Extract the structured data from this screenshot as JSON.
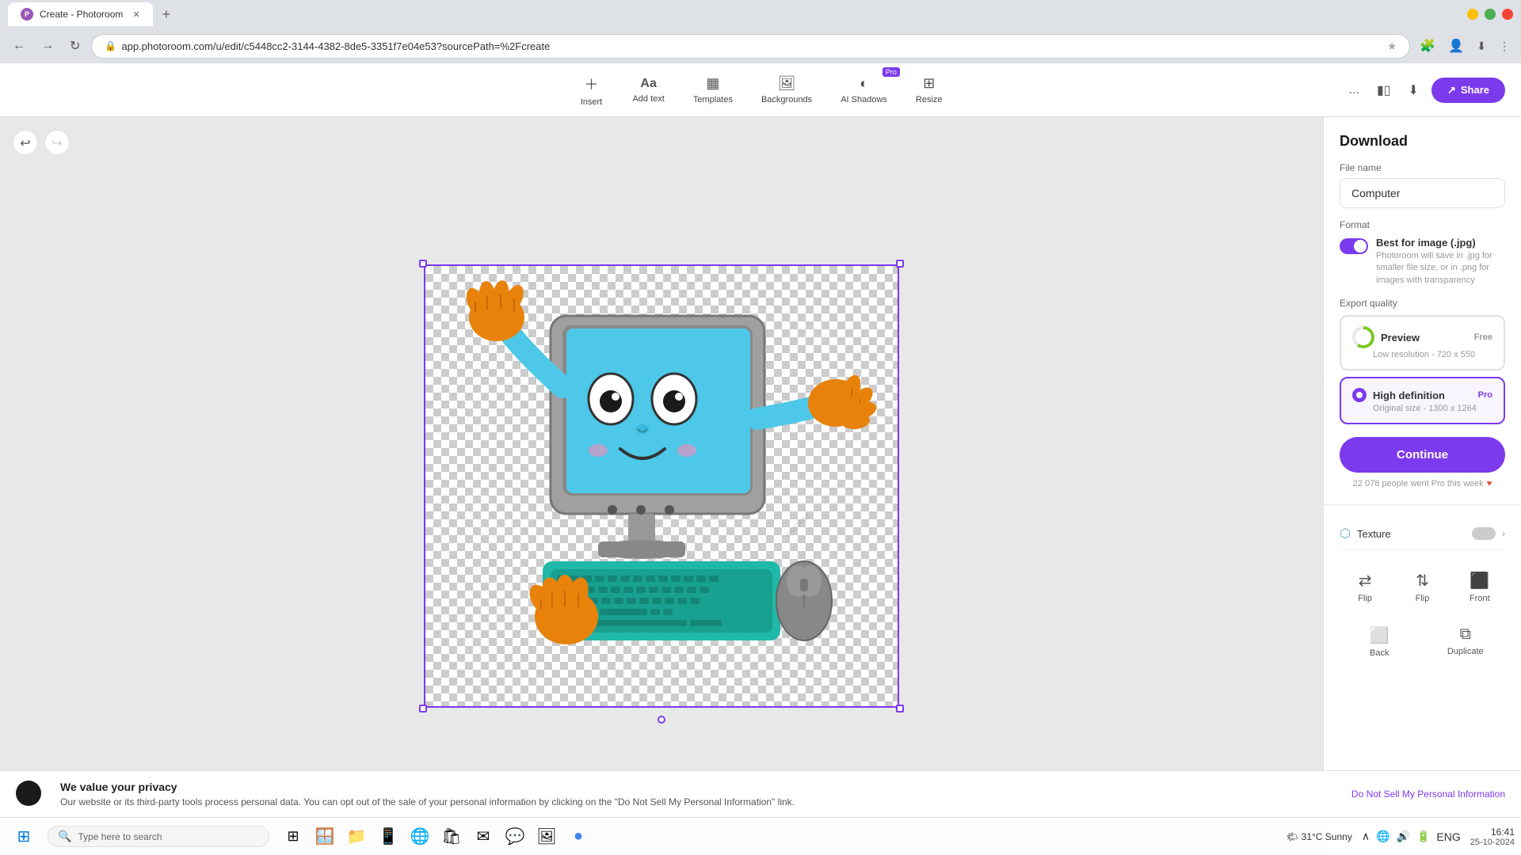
{
  "browser": {
    "tab_title": "Create - Photoroom",
    "url": "app.photoroom.com/u/edit/c5448cc2-3144-4382-8de5-3351f7e04e53?sourcePath=%2Fcreate",
    "new_tab_label": "+",
    "window_controls": [
      "minimize",
      "maximize",
      "close"
    ]
  },
  "toolbar": {
    "insert_label": "Insert",
    "add_text_label": "Add text",
    "templates_label": "Templates",
    "backgrounds_label": "Backgrounds",
    "ai_shadows_label": "AI Shadows",
    "resize_label": "Resize",
    "share_label": "Share",
    "more_label": "..."
  },
  "download_panel": {
    "title": "Download",
    "file_name_label": "File name",
    "file_name_value": "Computer",
    "format_label": "Format",
    "format_name": "Best for image (.jpg)",
    "format_desc": "Photoroom will save in .jpg for smaller file size, or in .png for images with transparency",
    "export_quality_label": "Export quality",
    "quality_options": [
      {
        "name": "Preview",
        "sub": "Low resolution - 720 x 550",
        "badge": "Free",
        "selected": false,
        "loading": true
      },
      {
        "name": "High definition",
        "sub": "Original size - 1300 x 1264",
        "badge": "Pro",
        "selected": true,
        "loading": false
      }
    ],
    "continue_label": "Continue",
    "promo_text": "22 078 people went Pro this week"
  },
  "bottom_tools": {
    "texture_label": "Texture",
    "tools": [
      {
        "icon": "↔",
        "label": "Flip"
      },
      {
        "icon": "↕",
        "label": "Flip"
      },
      {
        "icon": "⬛",
        "label": "Front"
      },
      {
        "icon": "⬜",
        "label": "Back"
      },
      {
        "icon": "⧉",
        "label": "Duplicate"
      }
    ]
  },
  "privacy": {
    "title": "We value your privacy",
    "text": "Our website or its third-party tools process personal data. You can opt out of the sale of your personal information by clicking on the \"Do Not Sell My Personal Information\" link.",
    "link_label": "Do Not Sell My Personal Information"
  },
  "taskbar": {
    "search_placeholder": "Type here to search",
    "weather": "31°C  Sunny",
    "time": "16:41",
    "date": "25-10-2024",
    "locale": "ENG"
  }
}
